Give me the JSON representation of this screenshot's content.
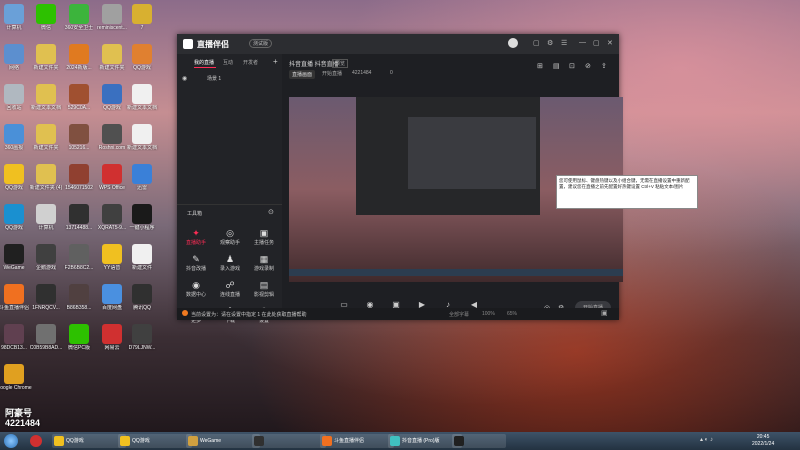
{
  "desktop": {
    "icons": [
      {
        "label": "计算机",
        "color": "#6aa0d8"
      },
      {
        "label": "微信",
        "color": "#2dc100"
      },
      {
        "label": "360安全卫士",
        "color": "#3cb43c"
      },
      {
        "label": "reminiscent...",
        "color": "#a0a0a0"
      },
      {
        "label": "7",
        "color": "#d8b030"
      },
      {
        "label": "网络",
        "color": "#5c8fcf"
      },
      {
        "label": "新建文件夹",
        "color": "#e0c050"
      },
      {
        "label": "2024新版...",
        "color": "#e07a20"
      },
      {
        "label": "新建文件夹",
        "color": "#e0c050"
      },
      {
        "label": "QQ游戏",
        "color": "#e08030"
      },
      {
        "label": "回收站",
        "color": "#b0b8c0"
      },
      {
        "label": "新建文本文档",
        "color": "#e0c050"
      },
      {
        "label": "529C0A...",
        "color": "#a05030"
      },
      {
        "label": "QQ游戏",
        "color": "#3a70c0"
      },
      {
        "label": "新建文本文档",
        "color": "#f0f0f0"
      },
      {
        "label": "360画报",
        "color": "#4a90d8"
      },
      {
        "label": "新建文件夹",
        "color": "#e0c050"
      },
      {
        "label": "105216...",
        "color": "#805040"
      },
      {
        "label": "Roshni.com",
        "color": "#505050"
      },
      {
        "label": "新建文本文档",
        "color": "#f0f0f0"
      },
      {
        "label": "QQ游戏",
        "color": "#f0c020"
      },
      {
        "label": "新建文件夹 (4)",
        "color": "#e0c050"
      },
      {
        "label": "1546071502",
        "color": "#904030"
      },
      {
        "label": "WPS Office",
        "color": "#d03030"
      },
      {
        "label": "迅雷",
        "color": "#3a80d8"
      },
      {
        "label": "QQ游戏",
        "color": "#1a90d0"
      },
      {
        "label": "计算机",
        "color": "#d0d0d0"
      },
      {
        "label": "13714488...",
        "color": "#303030"
      },
      {
        "label": "XQRAT5-9...",
        "color": "#404040"
      },
      {
        "label": "一键小程序",
        "color": "#1a1a1a"
      },
      {
        "label": "WeGame",
        "color": "#202020"
      },
      {
        "label": "企鹅游戏",
        "color": "#404040"
      },
      {
        "label": "F2B6B8C2...",
        "color": "#606060"
      },
      {
        "label": "YY语音",
        "color": "#f0c020"
      },
      {
        "label": "新建文件",
        "color": "#f0f0f0"
      },
      {
        "label": "斗鱼直播伴侣",
        "color": "#f07020"
      },
      {
        "label": "1FNRQCV...",
        "color": "#303030"
      },
      {
        "label": "B86B358...",
        "color": "#504040"
      },
      {
        "label": "百度网盘",
        "color": "#4a90e0"
      },
      {
        "label": "腾讯QQ",
        "color": "#303030"
      },
      {
        "label": "98DCB13...",
        "color": "#604050"
      },
      {
        "label": "C0B59B8AD...",
        "color": "#707070"
      },
      {
        "label": "微信PC版",
        "color": "#2dc100"
      },
      {
        "label": "网易云",
        "color": "#d03030"
      },
      {
        "label": "D79LJNW...",
        "color": "#404040"
      },
      {
        "label": "Google Chrome",
        "color": "#e0a020"
      }
    ]
  },
  "watermark": {
    "name": "阿豪号",
    "id": "4221484"
  },
  "app": {
    "title": "直播伴侣",
    "badge": "测试版",
    "left_tabs": [
      "我的直播",
      "互动",
      "开发者"
    ],
    "scene_label": "场景 1",
    "section_label": "工具箱",
    "tools": [
      {
        "label": "直播助手",
        "icon": "✦",
        "highlight": true
      },
      {
        "label": "观察助手",
        "icon": "◎",
        "highlight": false
      },
      {
        "label": "主播任务",
        "icon": "▣",
        "highlight": false
      },
      {
        "label": "抖音改播",
        "icon": "✎",
        "highlight": false
      },
      {
        "label": "录入游戏",
        "icon": "♟",
        "highlight": false
      },
      {
        "label": "游戏录制",
        "icon": "▦",
        "highlight": false
      },
      {
        "label": "数据中心",
        "icon": "◉",
        "highlight": false
      },
      {
        "label": "连线直播",
        "icon": "☍",
        "highlight": false
      },
      {
        "label": "影视剪辑",
        "icon": "▤",
        "highlight": false
      },
      {
        "label": "更多",
        "icon": "⬚",
        "highlight": false
      },
      {
        "label": "下载",
        "icon": "⬇",
        "highlight": false
      },
      {
        "label": "设置",
        "icon": "⚙",
        "highlight": false
      }
    ],
    "preview_header": {
      "title": "抖音直播 抖音直播",
      "badge": "预览",
      "tags": [
        "直播画面",
        "开始直播",
        "4221484",
        "0"
      ]
    },
    "bottom_tools": [
      {
        "label": "直播设置",
        "icon": "▭"
      },
      {
        "label": "摄像头",
        "icon": "◉"
      },
      {
        "label": "多机位置",
        "icon": "▣"
      },
      {
        "label": "录像播",
        "icon": "▶"
      },
      {
        "label": "麦克风",
        "icon": "♪"
      },
      {
        "label": "扬声器",
        "icon": "◀"
      }
    ],
    "start_button": "开始直播",
    "status_text": "当前设置为：请在设置中指定 1 在此处获取直播帮助",
    "status_right": [
      "全部字幕",
      "100%",
      "65%"
    ]
  },
  "tooltip": {
    "text": "您可使用鼠标、键盘热键以及小组合键，无需在直播设置中重新配置，建议您在直播之前先配置好热键设置 Ctrl+V 粘贴文本/图片"
  },
  "taskbar": {
    "buttons": [
      {
        "label": "QQ游戏",
        "color": "#f0c020"
      },
      {
        "label": "QQ游戏",
        "color": "#f0c020"
      },
      {
        "label": "WeGame",
        "color": "#d0a040"
      },
      {
        "label": "",
        "color": "#303030"
      },
      {
        "label": "斗鱼直播伴侣",
        "color": "#f07020"
      },
      {
        "label": "抖音直播 (Pro)版",
        "color": "#40c0c0"
      },
      {
        "label": "",
        "color": "#202020"
      }
    ],
    "clock_time": "20:45",
    "clock_date": "2022/1/24"
  }
}
